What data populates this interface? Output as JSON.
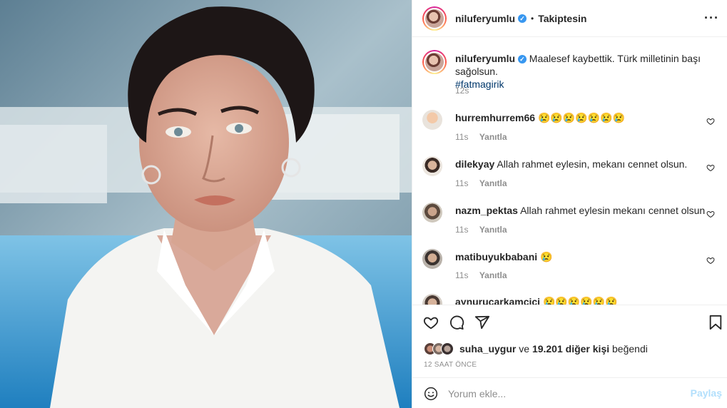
{
  "header": {
    "username": "niluferyumlu",
    "separator": "•",
    "follow_label": "Takiptesin",
    "more_icon": "more-options-icon"
  },
  "caption": {
    "username": "niluferyumlu",
    "text": "Maalesef kaybettik. Türk milletinin başı sağolsun.",
    "hashtag": "#fatmagirik",
    "time": "12s"
  },
  "comments": [
    {
      "username": "hurremhurrem66",
      "text": "😢😢😢😢😢😢😢",
      "time": "11s",
      "reply": "Yanıtla"
    },
    {
      "username": "dilekyay",
      "text": "Allah rahmet eylesin, mekanı cennet olsun.",
      "time": "11s",
      "reply": "Yanıtla"
    },
    {
      "username": "nazm_pektas",
      "text": "Allah rahmet eylesin mekanı cennet olsun",
      "time": "11s",
      "reply": "Yanıtla"
    },
    {
      "username": "matibuyukbabani",
      "text": "😢",
      "time": "11s",
      "reply": "Yanıtla"
    },
    {
      "username": "aynurucarkamcici",
      "text": "😢😢😢😢😢😢",
      "time": "",
      "reply": ""
    }
  ],
  "likes": {
    "user": "suha_uygur",
    "connector": "ve",
    "count": "19.201 diğer kişi",
    "suffix": "beğendi"
  },
  "timestamp": "12 SAAT ÖNCE",
  "add_comment": {
    "placeholder": "Yorum ekle...",
    "post_label": "Paylaş"
  },
  "colors": {
    "verified": "#3897f0",
    "hashtag": "#00376b",
    "muted": "#8e8e8e",
    "post_disabled": "#b2dffc"
  }
}
